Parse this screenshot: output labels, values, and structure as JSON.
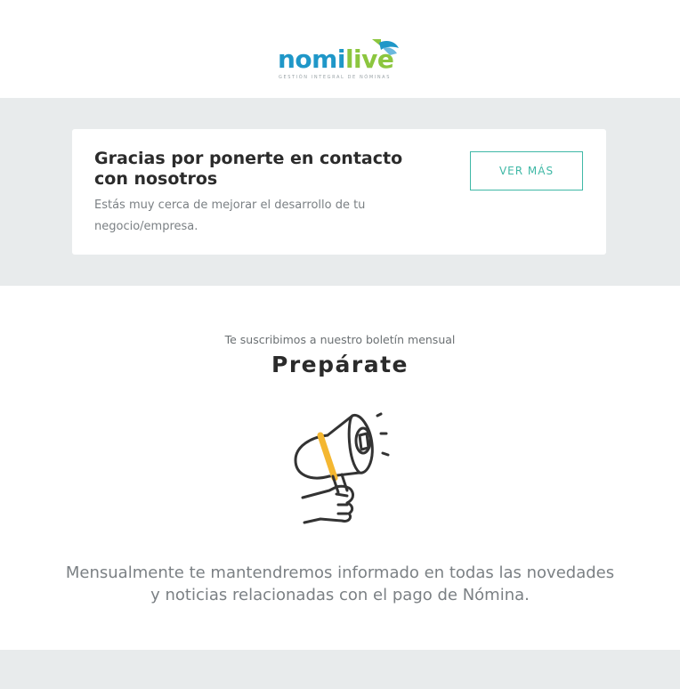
{
  "brand": {
    "logo_part1": "nomi",
    "logo_part2": "live",
    "tagline": "GESTIÓN INTEGRAL DE NÓMINAS",
    "colors": {
      "blue": "#1f97c8",
      "green": "#8cc63f",
      "teal": "#3fb8a6"
    }
  },
  "card": {
    "title": "Gracias por ponerte en contacto con nosotros",
    "subtitle": "Estás muy cerca de mejorar el desarrollo de tu negocio/empresa.",
    "button_label": "VER MÁS"
  },
  "newsletter": {
    "kicker": "Te suscribimos a nuestro boletín mensual",
    "headline": "Prepárate",
    "illustration": "megaphone-icon",
    "body": "Mensualmente te mantendremos informado en todas las novedades y noticias relacionadas con el pago de Nómina."
  }
}
